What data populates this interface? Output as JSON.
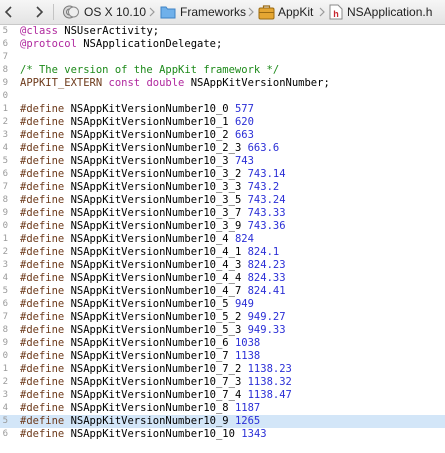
{
  "jumpbar": {
    "crumbs": [
      "OS X 10.10",
      "Frameworks",
      "AppKit",
      "NSApplication.h"
    ]
  },
  "code": {
    "class_kw": "@class",
    "class_name": "NSUserActivity;",
    "protocol_kw": "@protocol",
    "protocol_name": "NSApplicationDelegate;",
    "comment": "/* The version of the AppKit framework */",
    "extern_macro": "APPKIT_EXTERN",
    "extern_type": "const double",
    "extern_name": "NSAppKitVersionNumber;",
    "define_kw": "#define",
    "defines": [
      {
        "name": "NSAppKitVersionNumber10_0",
        "value": "577"
      },
      {
        "name": "NSAppKitVersionNumber10_1",
        "value": "620"
      },
      {
        "name": "NSAppKitVersionNumber10_2",
        "value": "663"
      },
      {
        "name": "NSAppKitVersionNumber10_2_3",
        "value": "663.6"
      },
      {
        "name": "NSAppKitVersionNumber10_3",
        "value": "743"
      },
      {
        "name": "NSAppKitVersionNumber10_3_2",
        "value": "743.14"
      },
      {
        "name": "NSAppKitVersionNumber10_3_3",
        "value": "743.2"
      },
      {
        "name": "NSAppKitVersionNumber10_3_5",
        "value": "743.24"
      },
      {
        "name": "NSAppKitVersionNumber10_3_7",
        "value": "743.33"
      },
      {
        "name": "NSAppKitVersionNumber10_3_9",
        "value": "743.36"
      },
      {
        "name": "NSAppKitVersionNumber10_4",
        "value": "824"
      },
      {
        "name": "NSAppKitVersionNumber10_4_1",
        "value": "824.1"
      },
      {
        "name": "NSAppKitVersionNumber10_4_3",
        "value": "824.23"
      },
      {
        "name": "NSAppKitVersionNumber10_4_4",
        "value": "824.33"
      },
      {
        "name": "NSAppKitVersionNumber10_4_7",
        "value": "824.41"
      },
      {
        "name": "NSAppKitVersionNumber10_5",
        "value": "949"
      },
      {
        "name": "NSAppKitVersionNumber10_5_2",
        "value": "949.27"
      },
      {
        "name": "NSAppKitVersionNumber10_5_3",
        "value": "949.33"
      },
      {
        "name": "NSAppKitVersionNumber10_6",
        "value": "1038"
      },
      {
        "name": "NSAppKitVersionNumber10_7",
        "value": "1138"
      },
      {
        "name": "NSAppKitVersionNumber10_7_2",
        "value": "1138.23"
      },
      {
        "name": "NSAppKitVersionNumber10_7_3",
        "value": "1138.32"
      },
      {
        "name": "NSAppKitVersionNumber10_7_4",
        "value": "1138.47"
      },
      {
        "name": "NSAppKitVersionNumber10_8",
        "value": "1187"
      },
      {
        "name": "NSAppKitVersionNumber10_9",
        "value": "1265"
      },
      {
        "name": "NSAppKitVersionNumber10_10",
        "value": "1343"
      }
    ]
  },
  "gutter": {
    "line_digits": [
      "5",
      "6",
      "7",
      "8",
      "9",
      "0",
      "1",
      "2",
      "3",
      "4",
      "5",
      "6",
      "7",
      "8",
      "9",
      "0",
      "1",
      "2",
      "3",
      "4",
      "5",
      "6",
      "7",
      "8",
      "9",
      "0",
      "1",
      "2",
      "3",
      "4",
      "5",
      "6",
      "7",
      "8"
    ]
  },
  "highlighted_define": "NSAppKitVersionNumber10_9",
  "colors": {
    "keyword": "#b0289e",
    "comment": "#1d8a1a",
    "number": "#2b2fd6",
    "macro": "#6d3a1b",
    "highlight": "#d3e6f8"
  },
  "icons": [
    "chevron-left-icon",
    "chevron-right-icon",
    "project-icon",
    "folder-icon",
    "framework-icon",
    "header-file-icon"
  ]
}
